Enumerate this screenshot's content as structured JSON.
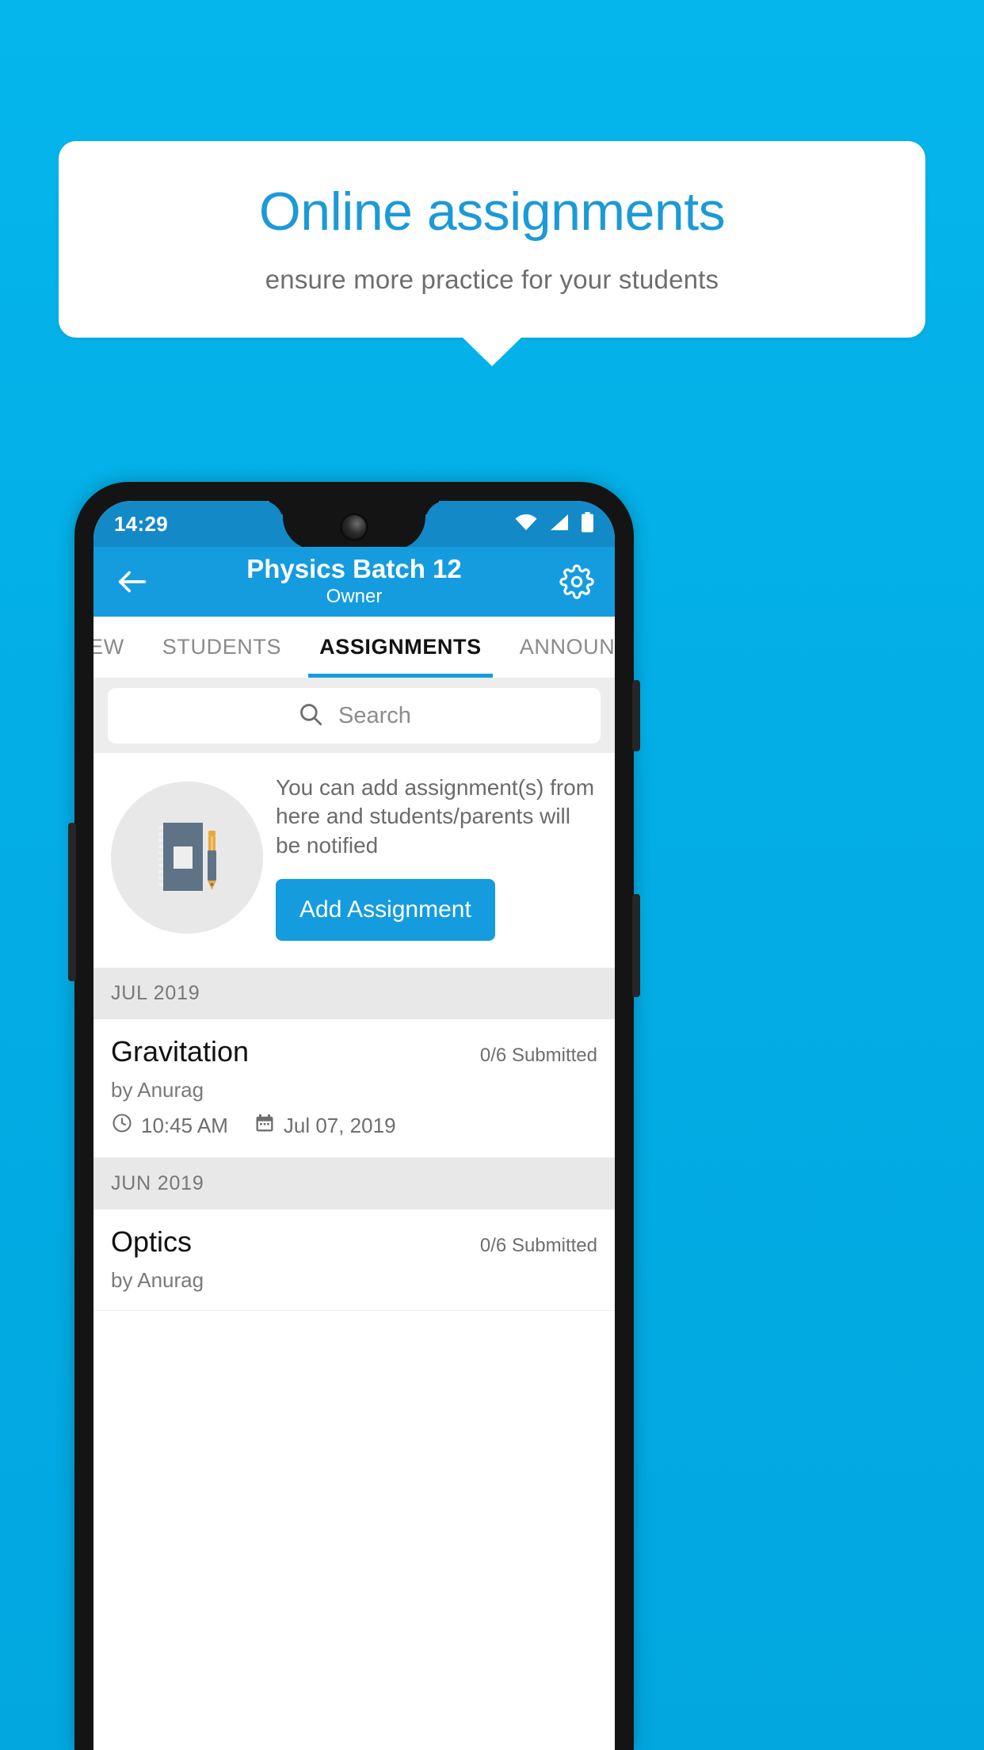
{
  "promo": {
    "title": "Online assignments",
    "subtitle": "ensure more practice for your students"
  },
  "colors": {
    "background": "#03ADE5",
    "accent": "#159CDF",
    "title_blue": "#1C9AD6",
    "statusbar": "#1389C8",
    "month_header_bg": "#E8E8E8"
  },
  "phone": {
    "statusbar": {
      "time": "14:29",
      "icons": [
        "wifi-icon",
        "signal-icon",
        "battery-icon"
      ]
    },
    "appbar": {
      "back_icon": "back-arrow-icon",
      "title": "Physics Batch 12",
      "subtitle": "Owner",
      "settings_icon": "gear-icon"
    },
    "tabs": [
      {
        "label": "IEW",
        "active": false
      },
      {
        "label": "STUDENTS",
        "active": false
      },
      {
        "label": "ASSIGNMENTS",
        "active": true
      },
      {
        "label": "ANNOUNCEM",
        "active": false
      }
    ],
    "search": {
      "icon": "search-icon",
      "placeholder": "Search",
      "value": ""
    },
    "empty_state": {
      "illustration": "notebook-pen-icon",
      "message": "You can add assignment(s) from here and students/parents will be notified",
      "button_label": "Add Assignment"
    },
    "groups": [
      {
        "month": "JUL 2019",
        "items": [
          {
            "title": "Gravitation",
            "submitted": "0/6 Submitted",
            "by": "by Anurag",
            "time_icon": "clock-icon",
            "time": "10:45 AM",
            "date_icon": "calendar-icon",
            "date": "Jul 07, 2019"
          }
        ]
      },
      {
        "month": "JUN 2019",
        "items": [
          {
            "title": "Optics",
            "submitted": "0/6 Submitted",
            "by": "by Anurag",
            "time_icon": "clock-icon",
            "time": "",
            "date_icon": "calendar-icon",
            "date": ""
          }
        ]
      }
    ]
  }
}
